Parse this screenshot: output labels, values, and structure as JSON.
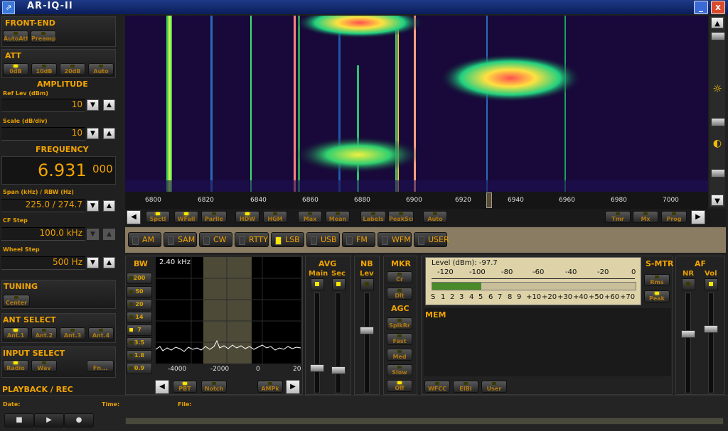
{
  "window": {
    "title": "AR-IQ-II",
    "minimize": "_",
    "close": "x"
  },
  "front_end": {
    "header": "FRONT-END",
    "buttons": [
      "AutoAtt",
      "Preamp"
    ]
  },
  "att": {
    "header": "ATT",
    "buttons": [
      "0dB",
      "10dB",
      "20dB",
      "Auto"
    ],
    "active": 0
  },
  "amplitude": {
    "header": "AMPLITUDE",
    "ref_lev_label": "Ref Lev (dBm)",
    "ref_lev_value": "10",
    "scale_label": "Scale (dB/div)",
    "scale_value": "10"
  },
  "frequency": {
    "header": "FREQUENCY",
    "main": "6.931",
    "sub": "000",
    "span_label": "Span (kHz) / RBW (Hz)",
    "span_value": "225.0 / 274.7",
    "cf_step_label": "CF Step",
    "cf_step_value": "100.0 kHz",
    "wheel_step_label": "Wheel Step",
    "wheel_step_value": "500 Hz"
  },
  "tuning": {
    "header": "TUNING",
    "button": "Center"
  },
  "ant_select": {
    "header": "ANT SELECT",
    "buttons": [
      "Ant.1",
      "Ant.2",
      "Ant.3",
      "Ant.4"
    ],
    "active": 0
  },
  "input_select": {
    "header": "INPUT SELECT",
    "buttons": [
      "Radio",
      "Wav",
      "Fn..."
    ],
    "active": 0
  },
  "playback": {
    "header": "PLAYBACK / REC",
    "date_label": "Date:",
    "time_label": "Time:",
    "file_label": "File:"
  },
  "freq_axis": {
    "ticks": [
      "6800",
      "6820",
      "6840",
      "6860",
      "6880",
      "6900",
      "6920",
      "6940",
      "6960",
      "6980",
      "7000"
    ]
  },
  "toolbar": {
    "buttons": [
      "Spctl",
      "WFall",
      "Parlle",
      "HDW",
      "HGM",
      "Max",
      "Mean",
      "Labels",
      "PeakScr",
      "Auto",
      "Tmr",
      "Mx",
      "Prog"
    ]
  },
  "modes": {
    "buttons": [
      "AM",
      "SAM",
      "CW",
      "RTTY",
      "LSB",
      "USB",
      "FM",
      "WFM",
      "USER"
    ],
    "active": "LSB"
  },
  "bw": {
    "header": "BW",
    "readout": "2.40 kHz",
    "buttons": [
      "200",
      "50",
      "20",
      "14",
      "7",
      "3.5",
      "1.8",
      "0.9"
    ],
    "active": "7",
    "axis_ticks": [
      "-4000",
      "-2000",
      "0",
      "20"
    ],
    "controls": [
      "PBT",
      "Notch",
      "AMPk"
    ]
  },
  "avg": {
    "header": "AVG",
    "main_label": "Main",
    "sec_label": "Sec"
  },
  "nb": {
    "header": "NB",
    "lev_label": "Lev"
  },
  "mkr": {
    "header": "MKR",
    "buttons": [
      "Cr",
      "Dlt"
    ]
  },
  "agc": {
    "header": "AGC",
    "buttons": [
      "SplkRr",
      "Fast",
      "Med",
      "Slow",
      "Off"
    ]
  },
  "meter": {
    "level_label": "Level (dBm): -97.7",
    "dbm_ticks": [
      "-120",
      "-100",
      "-80",
      "-60",
      "-40",
      "-20",
      "0"
    ],
    "s_ticks": [
      "S",
      "1",
      "2",
      "3",
      "4",
      "5",
      "6",
      "7",
      "8",
      "9",
      "+10",
      "+20",
      "+30",
      "+40",
      "+50",
      "+60",
      "+70"
    ],
    "bar_fraction": 0.24
  },
  "mem": {
    "header": "MEM",
    "buttons": [
      "WFCC",
      "EIBI",
      "User"
    ]
  },
  "smtr": {
    "header": "S-MTR",
    "buttons": [
      "Rms",
      "Peak"
    ]
  },
  "af": {
    "header": "AF",
    "nr_label": "NR",
    "vol_label": "Vol"
  },
  "colors": {
    "accent": "#f0a000",
    "led_on": "#ffe600",
    "titlebar": "#1e3a86"
  }
}
